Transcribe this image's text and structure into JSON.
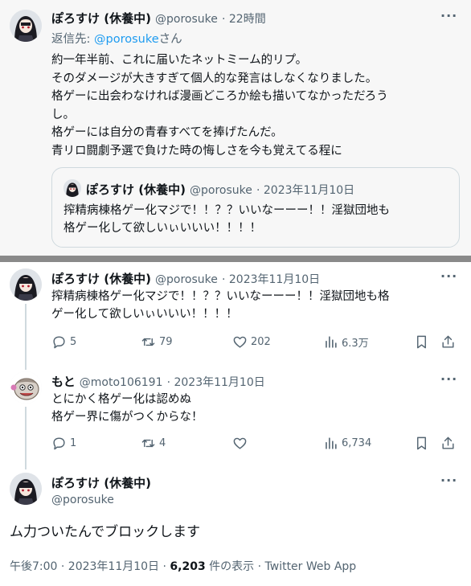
{
  "top_tweet": {
    "name": "ぽろすけ (休養中)",
    "handle": "@porosuke",
    "time": "· 22時間",
    "reply_prefix": "返信先: ",
    "reply_handle": "@porosuke",
    "reply_suffix": "さん",
    "text": "約一年半前、これに届いたネットミーム的リプ。\nそのダメージが大きすぎて個人的な発言はしなくなりました。\n格ゲーに出会わなければ漫画どころか絵も描いてなかっただろう\nし。\n格ゲーには自分の青春すべてを捧げたんだ。\n青リロ闘劇予選で負けた時の悔しさを今も覚えてる程に",
    "more": "···"
  },
  "quoted_tweet": {
    "name": "ぽろすけ (休養中)",
    "handle": "@porosuke",
    "date": "· 2023年11月10日",
    "text": "搾精病棟格ゲー化マジで！！？？いいなーーー！！淫獄団地も\n格ゲー化して欲しいぃいいい！！！！"
  },
  "thread": [
    {
      "name": "ぽろすけ (休養中)",
      "handle": "@porosuke",
      "date": "· 2023年11月10日",
      "text": "搾精病棟格ゲー化マジで！！？？いいなーーー！！淫獄団地も格\nゲー化して欲しいぃいいい！！！！",
      "more": "···",
      "replies": "5",
      "retweets": "79",
      "likes": "202",
      "views": "6.3万"
    },
    {
      "name": "もと",
      "handle": "@moto106191",
      "date": "· 2023年11月10日",
      "text": "とにかく格ゲー化は認めぬ\n格ゲー界に傷がつくからな！",
      "more": "···",
      "replies": "1",
      "retweets": "4",
      "likes": "",
      "views": "6,734"
    }
  ],
  "main_tweet": {
    "name": "ぽろすけ (休養中)",
    "handle": "@porosuke",
    "more": "···",
    "text": "ム力ついたんでブロックします",
    "time": "午後7:00 · 2023年11月10日 · ",
    "view_count": "6,203",
    "view_label": " 件の表示 · Twitter Web App"
  },
  "colors": {
    "link": "#1d9bf0",
    "secondary_text": "#536471",
    "border": "#cfd9de",
    "separator": "#8a8a8a"
  },
  "icons": [
    "reply-icon",
    "retweet-icon",
    "like-icon",
    "views-icon",
    "bookmark-icon",
    "share-icon",
    "more-icon"
  ]
}
